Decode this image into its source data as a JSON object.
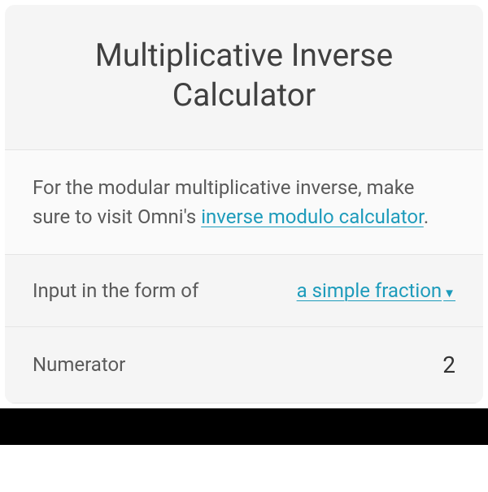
{
  "header": {
    "title": "Multiplicative Inverse Calculator"
  },
  "description": {
    "text_before": "For the modular multiplicative inverse, make sure to visit Omni's ",
    "link_text": "inverse modulo calculator",
    "text_after": "."
  },
  "form_type_row": {
    "label": "Input in the form of",
    "selected_value": "a simple fraction"
  },
  "numerator_row": {
    "label": "Numerator",
    "value": "2"
  }
}
